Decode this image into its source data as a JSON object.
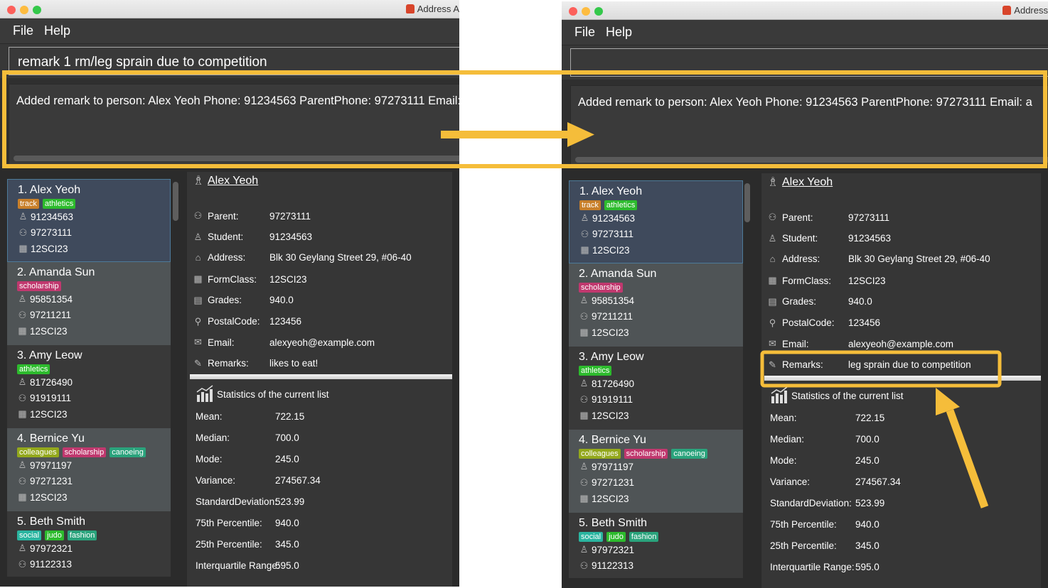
{
  "annotation_color": "#f5bd3a",
  "panels": [
    {
      "window_title": "Address A",
      "menu": [
        "File",
        "Help"
      ],
      "command_input": "remark 1 rm/leg sprain due to competition",
      "result": "Added remark to person: Alex Yeoh Phone: 91234563 ParentPhone: 97273111 Email: alex",
      "persons": [
        {
          "name": "1.  Alex Yeoh",
          "tags": [
            {
              "label": "track",
              "color": "#c87f2a"
            },
            {
              "label": "athletics",
              "color": "#2dbb2d"
            }
          ],
          "student": "91234563",
          "parent": "97273111",
          "formclass": "12SCI23"
        },
        {
          "name": "2.  Amanda Sun",
          "tags": [
            {
              "label": "scholarship",
              "color": "#c0386e"
            }
          ],
          "student": "95851354",
          "parent": "97211211",
          "formclass": "12SCI23"
        },
        {
          "name": "3.  Amy Leow",
          "tags": [
            {
              "label": "athletics",
              "color": "#2dbb2d"
            }
          ],
          "student": "81726490",
          "parent": "91919111",
          "formclass": "12SCI23"
        },
        {
          "name": "4.  Bernice Yu",
          "tags": [
            {
              "label": "colleagues",
              "color": "#93a81c"
            },
            {
              "label": "scholarship",
              "color": "#c0386e"
            },
            {
              "label": "canoeing",
              "color": "#2aa37c"
            }
          ],
          "student": "97971197",
          "parent": "97271231",
          "formclass": "12SCI23"
        },
        {
          "name": "5.  Beth Smith",
          "tags": [
            {
              "label": "social",
              "color": "#2ab5a0"
            },
            {
              "label": "judo",
              "color": "#2dbb2d"
            },
            {
              "label": "fashion",
              "color": "#2aa37c"
            }
          ],
          "student": "97972321",
          "parent": "91122313"
        }
      ],
      "details": {
        "name": "Alex Yeoh",
        "fields": [
          {
            "icon": "parent-icon",
            "label": "Parent:",
            "value": "97273111"
          },
          {
            "icon": "student-icon",
            "label": "Student:",
            "value": "91234563"
          },
          {
            "icon": "home-icon",
            "label": "Address:",
            "value": "Blk 30 Geylang Street 29, #06-40"
          },
          {
            "icon": "formclass-icon",
            "label": "FormClass:",
            "value": "12SCI23"
          },
          {
            "icon": "grades-icon",
            "label": "Grades:",
            "value": "940.0"
          },
          {
            "icon": "location-pin-icon",
            "label": "PostalCode:",
            "value": "123456"
          },
          {
            "icon": "email-icon",
            "label": "Email:",
            "value": "alexyeoh@example.com"
          },
          {
            "icon": "pencil-icon",
            "label": "Remarks:",
            "value": "likes to eat!"
          }
        ]
      },
      "stats": {
        "title": "Statistics of the current list",
        "rows": [
          {
            "label": "Mean:",
            "value": "722.15"
          },
          {
            "label": "Median:",
            "value": "700.0"
          },
          {
            "label": "Mode:",
            "value": "245.0"
          },
          {
            "label": "Variance:",
            "value": "274567.34"
          },
          {
            "label": "StandardDeviation:",
            "value": "523.99"
          },
          {
            "label": "75th Percentile:",
            "value": "940.0"
          },
          {
            "label": "25th Percentile:",
            "value": "345.0"
          },
          {
            "label": "Interquartile Range:",
            "value": "595.0"
          }
        ]
      }
    },
    {
      "window_title": "Address",
      "menu": [
        "File",
        "Help"
      ],
      "command_input": "",
      "result": "Added remark to person: Alex Yeoh Phone: 91234563 ParentPhone: 97273111 Email: a",
      "persons": [
        {
          "name": "1.  Alex Yeoh",
          "tags": [
            {
              "label": "track",
              "color": "#c87f2a"
            },
            {
              "label": "athletics",
              "color": "#2dbb2d"
            }
          ],
          "student": "91234563",
          "parent": "97273111",
          "formclass": "12SCI23"
        },
        {
          "name": "2.  Amanda Sun",
          "tags": [
            {
              "label": "scholarship",
              "color": "#c0386e"
            }
          ],
          "student": "95851354",
          "parent": "97211211",
          "formclass": "12SCI23"
        },
        {
          "name": "3.  Amy Leow",
          "tags": [
            {
              "label": "athletics",
              "color": "#2dbb2d"
            }
          ],
          "student": "81726490",
          "parent": "91919111",
          "formclass": "12SCI23"
        },
        {
          "name": "4.  Bernice Yu",
          "tags": [
            {
              "label": "colleagues",
              "color": "#93a81c"
            },
            {
              "label": "scholarship",
              "color": "#c0386e"
            },
            {
              "label": "canoeing",
              "color": "#2aa37c"
            }
          ],
          "student": "97971197",
          "parent": "97271231",
          "formclass": "12SCI23"
        },
        {
          "name": "5.  Beth Smith",
          "tags": [
            {
              "label": "social",
              "color": "#2ab5a0"
            },
            {
              "label": "judo",
              "color": "#2dbb2d"
            },
            {
              "label": "fashion",
              "color": "#2aa37c"
            }
          ],
          "student": "97972321",
          "parent": "91122313"
        }
      ],
      "details": {
        "name": "Alex Yeoh",
        "fields": [
          {
            "icon": "parent-icon",
            "label": "Parent:",
            "value": "97273111"
          },
          {
            "icon": "student-icon",
            "label": "Student:",
            "value": "91234563"
          },
          {
            "icon": "home-icon",
            "label": "Address:",
            "value": "Blk 30 Geylang Street 29, #06-40"
          },
          {
            "icon": "formclass-icon",
            "label": "FormClass:",
            "value": "12SCI23"
          },
          {
            "icon": "grades-icon",
            "label": "Grades:",
            "value": "940.0"
          },
          {
            "icon": "location-pin-icon",
            "label": "PostalCode:",
            "value": "123456"
          },
          {
            "icon": "email-icon",
            "label": "Email:",
            "value": "alexyeoh@example.com"
          },
          {
            "icon": "pencil-icon",
            "label": "Remarks:",
            "value": "leg sprain due to competition"
          }
        ]
      },
      "stats": {
        "title": "Statistics of the current list",
        "rows": [
          {
            "label": "Mean:",
            "value": "722.15"
          },
          {
            "label": "Median:",
            "value": "700.0"
          },
          {
            "label": "Mode:",
            "value": "245.0"
          },
          {
            "label": "Variance:",
            "value": "274567.34"
          },
          {
            "label": "StandardDeviation:",
            "value": "523.99"
          },
          {
            "label": "75th Percentile:",
            "value": "940.0"
          },
          {
            "label": "25th Percentile:",
            "value": "345.0"
          },
          {
            "label": "Interquartile Range:",
            "value": "595.0"
          }
        ]
      }
    }
  ]
}
